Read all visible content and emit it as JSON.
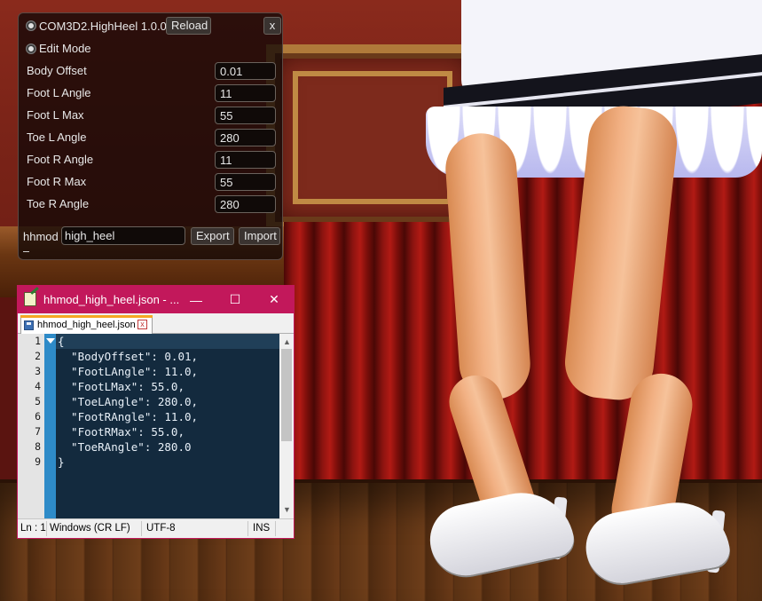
{
  "hh_window": {
    "title": "COM3D2.HighHeel 1.0.0",
    "reload_label": "Reload",
    "close_label": "x",
    "edit_mode_label": "Edit Mode",
    "fields": [
      {
        "label": "Body Offset",
        "value": "0.01"
      },
      {
        "label": "Foot L Angle",
        "value": "11"
      },
      {
        "label": "Foot L Max",
        "value": "55"
      },
      {
        "label": "Toe L Angle",
        "value": "280"
      },
      {
        "label": "Foot R Angle",
        "value": "11"
      },
      {
        "label": "Foot R Max",
        "value": "55"
      },
      {
        "label": "Toe R Angle",
        "value": "280"
      }
    ],
    "hhmod_label": "hhmod",
    "hhmod_value": "high_heel",
    "export_label": "Export",
    "import_label": "Import",
    "grip_label": "–"
  },
  "notepad": {
    "title": "hhmod_high_heel.json - ...",
    "min_label": "—",
    "max_label": "☐",
    "close_label": "✕",
    "tab_label": "hhmod_high_heel.json",
    "tab_close_label": "x",
    "lines": [
      {
        "n": "1",
        "code": "{"
      },
      {
        "n": "2",
        "code": "  \"BodyOffset\": 0.01,"
      },
      {
        "n": "3",
        "code": "  \"FootLAngle\": 11.0,"
      },
      {
        "n": "4",
        "code": "  \"FootLMax\": 55.0,"
      },
      {
        "n": "5",
        "code": "  \"ToeLAngle\": 280.0,"
      },
      {
        "n": "6",
        "code": "  \"FootRAngle\": 11.0,"
      },
      {
        "n": "7",
        "code": "  \"FootRMax\": 55.0,"
      },
      {
        "n": "8",
        "code": "  \"ToeRAngle\": 280.0"
      },
      {
        "n": "9",
        "code": "}"
      }
    ],
    "status": {
      "position": "Ln : 1",
      "eol": "Windows (CR LF)",
      "encoding": "UTF-8",
      "mode": "INS"
    }
  },
  "colors": {
    "notepad_titlebar": "#c2185b",
    "editor_bg": "#132a3e",
    "fold_margin": "#2e8bc8",
    "tab_accent": "#f5a623"
  }
}
